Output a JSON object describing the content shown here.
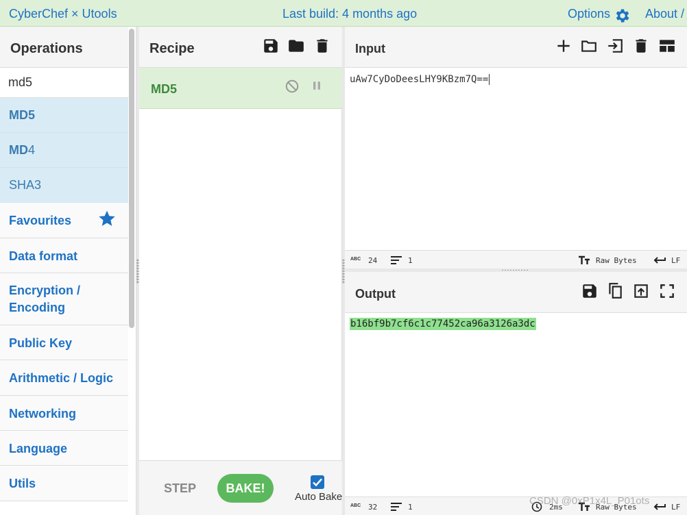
{
  "banner": {
    "app_title": "CyberChef × Utools",
    "build": "Last build: 4 months ago",
    "options": "Options",
    "about": "About /"
  },
  "operations": {
    "title": "Operations",
    "search_value": "md5",
    "results": [
      {
        "bold": "MD5",
        "rest": ""
      },
      {
        "bold": "MD",
        "rest": "4"
      },
      {
        "bold": "",
        "rest": "SHA3"
      }
    ],
    "categories": [
      "Favourites",
      "Data format",
      "Encryption / Encoding",
      "Public Key",
      "Arithmetic / Logic",
      "Networking",
      "Language",
      "Utils"
    ]
  },
  "recipe": {
    "title": "Recipe",
    "operation": "MD5",
    "step_label": "STEP",
    "bake_label": "BAKE!",
    "auto_bake_label": "Auto Bake",
    "auto_bake_checked": true
  },
  "input": {
    "title": "Input",
    "text": "uAw7CyDoDeesLHY9KBzm7Q==",
    "length": "24",
    "lines": "1",
    "encoding": "Raw Bytes",
    "eol": "LF"
  },
  "output": {
    "title": "Output",
    "text": "b16bf9b7cf6c1c77452ca96a3126a3dc",
    "length": "32",
    "lines": "1",
    "time": "2ms",
    "encoding": "Raw Bytes",
    "eol": "LF"
  },
  "watermark": "CSDN @0xP1x4L_P01ots",
  "colors": {
    "banner_bg": "#dff0d8",
    "link_blue": "#1e72c4",
    "recipe_op_bg": "#dff0d8",
    "bake_green": "#5cb85c",
    "output_highlight": "#8fe08f",
    "search_result_bg": "#d9ecf5"
  }
}
